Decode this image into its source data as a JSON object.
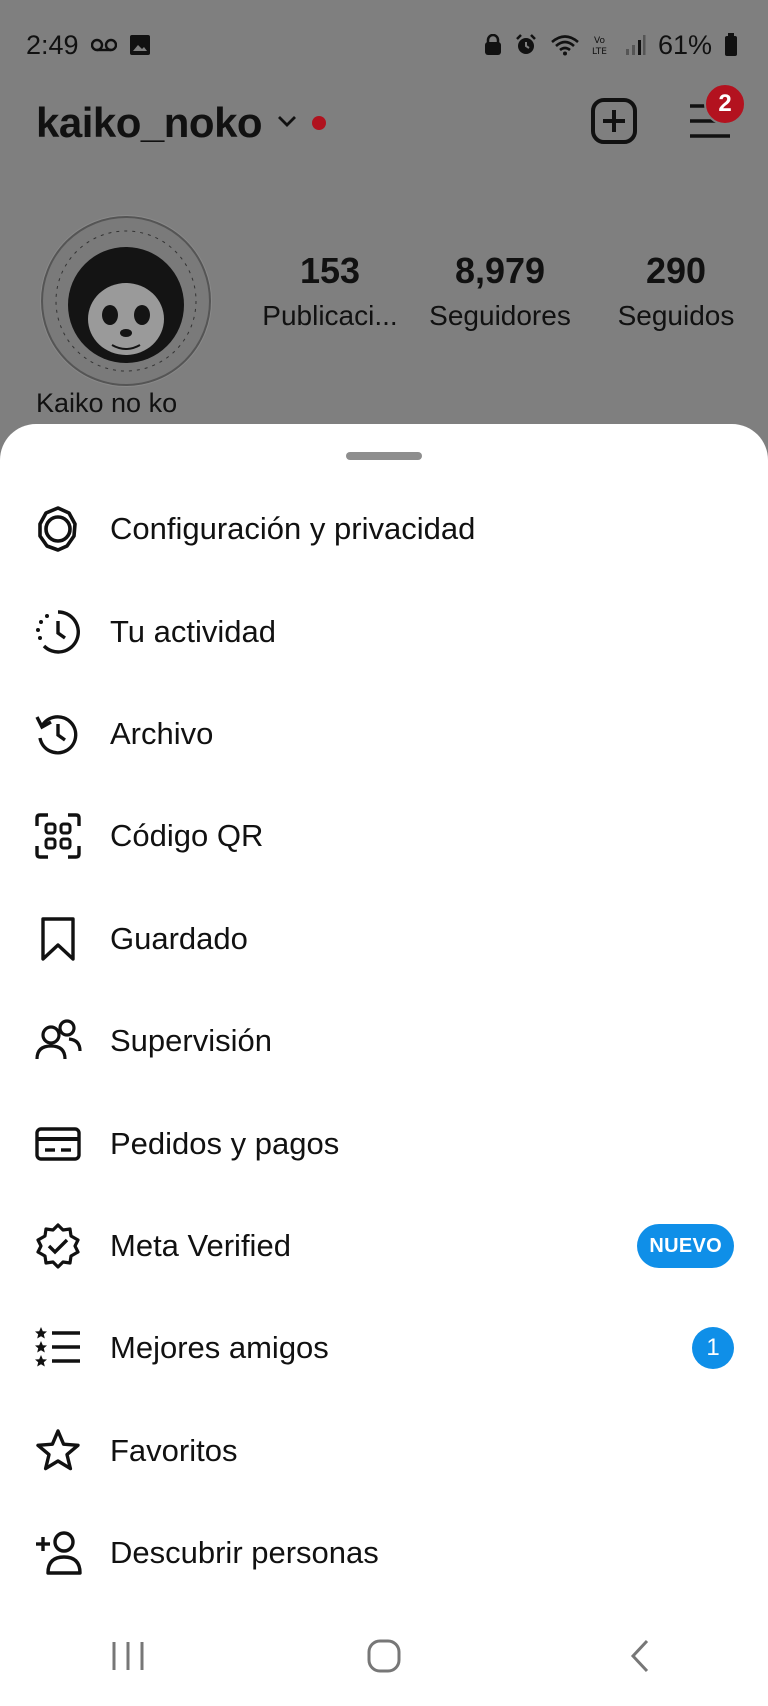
{
  "status_bar": {
    "time": "2:49",
    "battery": "61%"
  },
  "profile": {
    "username": "kaiko_noko",
    "notification_count": "2",
    "stats": [
      {
        "value": "153",
        "label": "Publicaci..."
      },
      {
        "value": "8,979",
        "label": "Seguidores"
      },
      {
        "value": "290",
        "label": "Seguidos"
      }
    ],
    "display_name": "Kaiko no ko"
  },
  "menu": {
    "items": [
      {
        "label": "Configuración y privacidad",
        "icon": "settings-gear-icon"
      },
      {
        "label": "Tu actividad",
        "icon": "activity-clock-icon"
      },
      {
        "label": "Archivo",
        "icon": "archive-history-icon"
      },
      {
        "label": "Código QR",
        "icon": "qr-code-icon"
      },
      {
        "label": "Guardado",
        "icon": "bookmark-icon"
      },
      {
        "label": "Supervisión",
        "icon": "supervision-people-icon"
      },
      {
        "label": "Pedidos y pagos",
        "icon": "credit-card-icon"
      },
      {
        "label": "Meta Verified",
        "icon": "verified-badge-icon",
        "badge": "NUEVO"
      },
      {
        "label": "Mejores amigos",
        "icon": "close-friends-list-icon",
        "badge": "1"
      },
      {
        "label": "Favoritos",
        "icon": "star-icon"
      },
      {
        "label": "Descubrir personas",
        "icon": "add-person-icon"
      }
    ]
  },
  "colors": {
    "accent_blue": "#0f8fe8",
    "notification_red": "#b3121f",
    "overlay": "#7f7f7f"
  }
}
